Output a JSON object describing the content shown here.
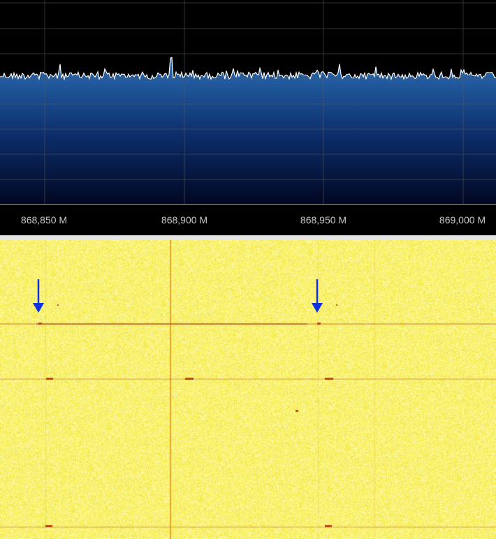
{
  "spectrum": {
    "trace_color": "#ffffff",
    "fill_top_color": "#2a6db5",
    "fill_bottom_color": "#020722",
    "grid_color": "#5a5a5a",
    "baseline_level": 0.37
  },
  "frequency_axis": {
    "labels": [
      "868,850 M",
      "868,900 M",
      "868,950 M",
      "869,000 M"
    ],
    "label_color": "#c8c8c8"
  },
  "waterfall": {
    "background_color": "#f3f060",
    "signal_color": "#b8461a",
    "center_line_color": "#e8a020"
  },
  "annotations": {
    "arrow_color": "#1030e0",
    "arrows": [
      {
        "name": "left-signal-marker"
      },
      {
        "name": "right-signal-marker"
      }
    ]
  }
}
